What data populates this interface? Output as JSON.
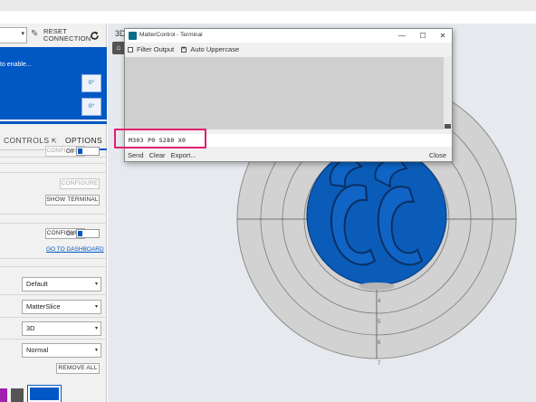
{
  "connection": {
    "reset_label_1": "RESET",
    "reset_label_2": "CONNECTION"
  },
  "printer_status": {
    "message": "to enable...",
    "temp_1": "0°",
    "temp_2": "0°"
  },
  "tabs": {
    "controls": "CONTROLS",
    "options": "OPTIONS"
  },
  "left_panel": {
    "configure_1": "CONFIGURE",
    "off_1": "Off",
    "configure_2": "CONFIGURE",
    "show_terminal": "SHOW TERMINAL",
    "configure_3": "CONFIGURE",
    "off_2": "Off",
    "go_to_dashboard": "GO TO DASHBOARD",
    "selects": [
      "Default",
      "MatterSlice",
      "3D",
      "Normal"
    ],
    "remove_all": "REMOVE ALL",
    "colors": {
      "accent": "#0058c4",
      "swatch_purple": "#a020b0",
      "swatch_gray": "#555555"
    }
  },
  "view": {
    "label": "3D"
  },
  "terminal": {
    "title": "MatterControl - Terminal",
    "filter_output": "Filter Output",
    "filter_output_checked": false,
    "auto_uppercase": "Auto Uppercase",
    "auto_uppercase_checked": true,
    "input_value": "M303 P0 S280 X0",
    "send": "Send",
    "clear": "Clear",
    "export": "Export...",
    "close": "Close",
    "highlight_color": "#e0206f"
  },
  "bed_ruler": [
    "4",
    "5",
    "6",
    "7"
  ]
}
